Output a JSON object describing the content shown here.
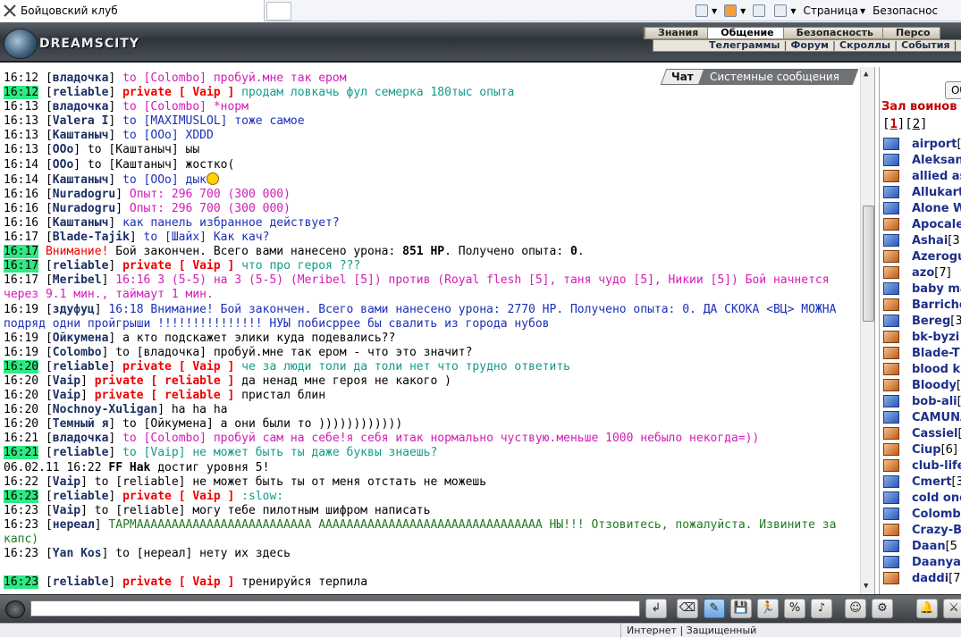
{
  "browser": {
    "tab_title": "Бойцовский клуб",
    "toolbar": {
      "page_label": "Страница",
      "security_label": "Безопаснос"
    }
  },
  "header": {
    "logo_text": "DREAMSCITY",
    "menu1": [
      "Знания",
      "Общение",
      "Безопасность",
      "Персо"
    ],
    "menu1_active": "Общение",
    "menu2": [
      "Телеграммы",
      "Форум",
      "Скроллы",
      "События",
      "ЖЗ"
    ]
  },
  "chat_tabs": {
    "chat": "Чат",
    "system": "Системные сообщения"
  },
  "chat": [
    {
      "time": "16:12",
      "hl": false,
      "segs": [
        {
          "c": "br",
          "t": "["
        },
        {
          "c": "u",
          "t": "владочка"
        },
        {
          "c": "br",
          "t": "] "
        },
        {
          "c": "txtm",
          "t": "to [Colombo] пробуй.мне так ером"
        }
      ]
    },
    {
      "time": "16:12",
      "hl": true,
      "segs": [
        {
          "c": "br",
          "t": "["
        },
        {
          "c": "u",
          "t": "reliable"
        },
        {
          "c": "br",
          "t": "] "
        },
        {
          "c": "p",
          "t": "private [ Vaip ]"
        },
        {
          "c": "txtg",
          "t": " продам ловкачь фул семерка 180тыс опыта"
        }
      ]
    },
    {
      "time": "16:13",
      "hl": false,
      "segs": [
        {
          "c": "br",
          "t": "["
        },
        {
          "c": "u",
          "t": "владочка"
        },
        {
          "c": "br",
          "t": "] "
        },
        {
          "c": "txtm",
          "t": "to [Colombo] *норм"
        }
      ]
    },
    {
      "time": "16:13",
      "hl": false,
      "segs": [
        {
          "c": "br",
          "t": "["
        },
        {
          "c": "u",
          "t": "Valera I"
        },
        {
          "c": "br",
          "t": "] "
        },
        {
          "c": "txtb",
          "t": "to [MAXIMUSLOL] тоже самое"
        }
      ]
    },
    {
      "time": "16:13",
      "hl": false,
      "segs": [
        {
          "c": "br",
          "t": "["
        },
        {
          "c": "u",
          "t": "Каштаныч"
        },
        {
          "c": "br",
          "t": "] "
        },
        {
          "c": "txtb",
          "t": "to [OOo] XDDD"
        }
      ]
    },
    {
      "time": "16:13",
      "hl": false,
      "segs": [
        {
          "c": "br",
          "t": "["
        },
        {
          "c": "u",
          "t": "OOo"
        },
        {
          "c": "br",
          "t": "] "
        },
        {
          "c": "t",
          "t": "to [Каштаныч] ыы"
        }
      ]
    },
    {
      "time": "16:14",
      "hl": false,
      "segs": [
        {
          "c": "br",
          "t": "["
        },
        {
          "c": "u",
          "t": "OOo"
        },
        {
          "c": "br",
          "t": "] "
        },
        {
          "c": "t",
          "t": "to [Каштаныч] жостко("
        }
      ]
    },
    {
      "time": "16:14",
      "hl": false,
      "smile": true,
      "segs": [
        {
          "c": "br",
          "t": "["
        },
        {
          "c": "u",
          "t": "Каштаныч"
        },
        {
          "c": "br",
          "t": "] "
        },
        {
          "c": "txtb",
          "t": "to [OOo] дык"
        }
      ]
    },
    {
      "time": "16:16",
      "hl": false,
      "segs": [
        {
          "c": "br",
          "t": "["
        },
        {
          "c": "u",
          "t": "Nuradogru"
        },
        {
          "c": "br",
          "t": "] "
        },
        {
          "c": "txtm",
          "t": "Опыт: 296 700 (300 000)"
        }
      ]
    },
    {
      "time": "16:16",
      "hl": false,
      "segs": [
        {
          "c": "br",
          "t": "["
        },
        {
          "c": "u",
          "t": "Nuradogru"
        },
        {
          "c": "br",
          "t": "] "
        },
        {
          "c": "txtm",
          "t": "Опыт: 296 700 (300 000)"
        }
      ]
    },
    {
      "time": "16:16",
      "hl": false,
      "segs": [
        {
          "c": "br",
          "t": "["
        },
        {
          "c": "u",
          "t": "Каштаныч"
        },
        {
          "c": "br",
          "t": "] "
        },
        {
          "c": "txtb",
          "t": "как панель избранное действует?"
        }
      ]
    },
    {
      "time": "16:17",
      "hl": false,
      "segs": [
        {
          "c": "br",
          "t": "["
        },
        {
          "c": "u",
          "t": "Blade-Tajik"
        },
        {
          "c": "br",
          "t": "] "
        },
        {
          "c": "txtb",
          "t": "to [Шайх] Как кач?"
        }
      ]
    },
    {
      "time": "16:17",
      "hl": true,
      "segs": [
        {
          "c": "red",
          "t": "Внимание!"
        },
        {
          "c": "t",
          "t": " Бой закончен. Всего вами нанесено урона: "
        },
        {
          "c": "bold",
          "t": "851 HP"
        },
        {
          "c": "t",
          "t": ". Получено опыта: "
        },
        {
          "c": "bold",
          "t": "0"
        },
        {
          "c": "t",
          "t": "."
        }
      ]
    },
    {
      "time": "16:17",
      "hl": true,
      "segs": [
        {
          "c": "br",
          "t": "["
        },
        {
          "c": "u",
          "t": "reliable"
        },
        {
          "c": "br",
          "t": "] "
        },
        {
          "c": "p",
          "t": "private [ Vaip ]"
        },
        {
          "c": "txtg",
          "t": " что про героя ???"
        }
      ]
    },
    {
      "time": "16:17",
      "hl": false,
      "segs": [
        {
          "c": "br",
          "t": "["
        },
        {
          "c": "u",
          "t": "Meribel"
        },
        {
          "c": "br",
          "t": "] "
        },
        {
          "c": "txtm",
          "t": "16:16 3 (5-5) на 3 (5-5) (Meribel [5]) против (Royal flesh [5], таня чудо [5], Никии [5]) Бой начнется через 9.1 мин., таймаут 1 мин."
        }
      ]
    },
    {
      "time": "16:19",
      "hl": false,
      "segs": [
        {
          "c": "br",
          "t": "["
        },
        {
          "c": "u",
          "t": "здуфуц"
        },
        {
          "c": "br",
          "t": "] "
        },
        {
          "c": "txtb",
          "t": "16:18 Внимание! Бой закончен. Всего вами нанесено урона: 2770 HP. Получено опыта: 0. ДА СКОКА <ВЦ> МОЖНА подряд одни пройгрыши !!!!!!!!!!!!!!! НУЫ побисррее бы свалить из города нубов"
        }
      ]
    },
    {
      "time": "16:19",
      "hl": false,
      "segs": [
        {
          "c": "br",
          "t": "["
        },
        {
          "c": "u",
          "t": "Ойкумена"
        },
        {
          "c": "br",
          "t": "] "
        },
        {
          "c": "t",
          "t": "а кто подскажет элики куда подевались??"
        }
      ]
    },
    {
      "time": "16:19",
      "hl": false,
      "segs": [
        {
          "c": "br",
          "t": "["
        },
        {
          "c": "u",
          "t": "Colombo"
        },
        {
          "c": "br",
          "t": "] "
        },
        {
          "c": "t",
          "t": "to [владочка] пробуй.мне так ером - что это значит?"
        }
      ]
    },
    {
      "time": "16:20",
      "hl": true,
      "segs": [
        {
          "c": "br",
          "t": "["
        },
        {
          "c": "u",
          "t": "reliable"
        },
        {
          "c": "br",
          "t": "] "
        },
        {
          "c": "p",
          "t": "private [ Vaip ]"
        },
        {
          "c": "txtg",
          "t": " че за люди толи да толи нет что трудно ответить"
        }
      ]
    },
    {
      "time": "16:20",
      "hl": false,
      "segs": [
        {
          "c": "br",
          "t": "["
        },
        {
          "c": "u",
          "t": "Vaip"
        },
        {
          "c": "br",
          "t": "] "
        },
        {
          "c": "p",
          "t": "private [ reliable ]"
        },
        {
          "c": "t",
          "t": " да ненад мне героя не какого )"
        }
      ]
    },
    {
      "time": "16:20",
      "hl": false,
      "segs": [
        {
          "c": "br",
          "t": "["
        },
        {
          "c": "u",
          "t": "Vaip"
        },
        {
          "c": "br",
          "t": "] "
        },
        {
          "c": "p",
          "t": "private [ reliable ]"
        },
        {
          "c": "t",
          "t": " пристал блин"
        }
      ]
    },
    {
      "time": "16:20",
      "hl": false,
      "segs": [
        {
          "c": "br",
          "t": "["
        },
        {
          "c": "u",
          "t": "Nochnoy-Xuligan"
        },
        {
          "c": "br",
          "t": "] "
        },
        {
          "c": "t",
          "t": "ha ha ha"
        }
      ]
    },
    {
      "time": "16:20",
      "hl": false,
      "segs": [
        {
          "c": "br",
          "t": "["
        },
        {
          "c": "u",
          "t": "Темный я"
        },
        {
          "c": "br",
          "t": "] "
        },
        {
          "c": "t",
          "t": "to [Ойкумена] а они были то ))))))))))))"
        }
      ]
    },
    {
      "time": "16:21",
      "hl": false,
      "segs": [
        {
          "c": "br",
          "t": "["
        },
        {
          "c": "u",
          "t": "владочка"
        },
        {
          "c": "br",
          "t": "] "
        },
        {
          "c": "txtm",
          "t": "to [Colombo] пробуй сам на себе!я себя итак нормально чуствую.меньше 1000 небыло некогда=))"
        }
      ]
    },
    {
      "time": "16:21",
      "hl": true,
      "segs": [
        {
          "c": "br",
          "t": "["
        },
        {
          "c": "u",
          "t": "reliable"
        },
        {
          "c": "br",
          "t": "] "
        },
        {
          "c": "txtg",
          "t": "to [Vaip] не может быть ты даже буквы знаешь?"
        }
      ]
    },
    {
      "time": "06.02.11 16:22",
      "hl": false,
      "segs": [
        {
          "c": "bold",
          "t": "FF Hak"
        },
        {
          "c": "t",
          "t": " достиг уровня 5!"
        }
      ]
    },
    {
      "time": "16:22",
      "hl": false,
      "segs": [
        {
          "c": "br",
          "t": "["
        },
        {
          "c": "u",
          "t": "Vaip"
        },
        {
          "c": "br",
          "t": "] "
        },
        {
          "c": "t",
          "t": "to [reliable] не может быть ты от меня отстать не можешь"
        }
      ]
    },
    {
      "time": "16:23",
      "hl": true,
      "segs": [
        {
          "c": "br",
          "t": "["
        },
        {
          "c": "u",
          "t": "reliable"
        },
        {
          "c": "br",
          "t": "] "
        },
        {
          "c": "p",
          "t": "private [ Vaip ]"
        },
        {
          "c": "txtg",
          "t": " :slow:"
        }
      ]
    },
    {
      "time": "16:23",
      "hl": false,
      "segs": [
        {
          "c": "br",
          "t": "["
        },
        {
          "c": "u",
          "t": "Vaip"
        },
        {
          "c": "br",
          "t": "] "
        },
        {
          "c": "t",
          "t": "to [reliable] могу тебе пилотным шифром написать"
        }
      ]
    },
    {
      "time": "16:23",
      "hl": false,
      "segs": [
        {
          "c": "br",
          "t": "["
        },
        {
          "c": "u",
          "t": "нереал"
        },
        {
          "c": "br",
          "t": "] "
        },
        {
          "c": "txtgrn",
          "t": "ТАРМААААААААААААААААААААААААА АААААААААААААААААААААААААААААААА НЫ!!! Отзовитесь, пожалуйста. Извините за капс)"
        }
      ]
    },
    {
      "time": "16:23",
      "hl": false,
      "segs": [
        {
          "c": "br",
          "t": "["
        },
        {
          "c": "u",
          "t": "Yan Kos"
        },
        {
          "c": "br",
          "t": "] "
        },
        {
          "c": "t",
          "t": "to [нереал] нету их здесь"
        }
      ]
    },
    {
      "time": "",
      "hl": false,
      "segs": [
        {
          "c": "t",
          "t": " "
        }
      ]
    },
    {
      "time": "16:23",
      "hl": true,
      "segs": [
        {
          "c": "br",
          "t": "["
        },
        {
          "c": "u",
          "t": "reliable"
        },
        {
          "c": "br",
          "t": "] "
        },
        {
          "c": "p",
          "t": "private [ Vaip ]"
        },
        {
          "c": "t",
          "t": " тренируйся терпила"
        }
      ]
    }
  ],
  "right_panel": {
    "refresh_label": "Об",
    "hall_title": "Зал воинов (",
    "pages": [
      "1",
      "2"
    ],
    "players": [
      {
        "name": "airport",
        "lv": "[",
        "icon": "b"
      },
      {
        "name": "Aleksan",
        "lv": "",
        "icon": "b"
      },
      {
        "name": "allied as",
        "lv": "",
        "icon": "r"
      },
      {
        "name": "Allukart",
        "lv": "",
        "icon": "b"
      },
      {
        "name": "Alone W",
        "lv": "",
        "icon": "b"
      },
      {
        "name": "Apocale",
        "lv": "",
        "icon": "r"
      },
      {
        "name": "Ashai",
        "lv": "[3",
        "icon": "b"
      },
      {
        "name": "Azerogu",
        "lv": "",
        "icon": "r"
      },
      {
        "name": "azo",
        "lv": "[7]",
        "icon": "r"
      },
      {
        "name": "baby ma",
        "lv": "",
        "icon": "b"
      },
      {
        "name": "Barriche",
        "lv": "",
        "icon": "r"
      },
      {
        "name": "Bereg",
        "lv": "[3",
        "icon": "b"
      },
      {
        "name": "bk-byzi",
        "lv": "",
        "icon": "r"
      },
      {
        "name": "Blade-T",
        "lv": "",
        "icon": "r"
      },
      {
        "name": "blood ki",
        "lv": "",
        "icon": "r"
      },
      {
        "name": "Bloody",
        "lv": "[",
        "icon": "r"
      },
      {
        "name": "bob-ali",
        "lv": "[",
        "icon": "b"
      },
      {
        "name": "CAMUNA",
        "lv": "",
        "icon": "b"
      },
      {
        "name": "Cassiel",
        "lv": "[",
        "icon": "r"
      },
      {
        "name": "Ciup",
        "lv": "[6]",
        "icon": "r"
      },
      {
        "name": "club-life",
        "lv": "",
        "icon": "r"
      },
      {
        "name": "Cmert",
        "lv": "[3",
        "icon": "b"
      },
      {
        "name": "cold one",
        "lv": "",
        "icon": "b"
      },
      {
        "name": "Colomb",
        "lv": "",
        "icon": "b"
      },
      {
        "name": "Crazy-B",
        "lv": "",
        "icon": "r"
      },
      {
        "name": "Daan",
        "lv": "[5",
        "icon": "b"
      },
      {
        "name": "Daanya",
        "lv": "",
        "icon": "b"
      },
      {
        "name": "daddi",
        "lv": "[7",
        "icon": "r"
      }
    ]
  },
  "bottom": {
    "input_value": "",
    "buttons": [
      "↲",
      "⌫",
      "✎",
      "💾",
      "🏃",
      "%",
      "♪",
      "☺",
      "⚙",
      "🔔",
      "⚔"
    ]
  },
  "statusbar": {
    "zone_text": "Интернет | Защищенный"
  }
}
